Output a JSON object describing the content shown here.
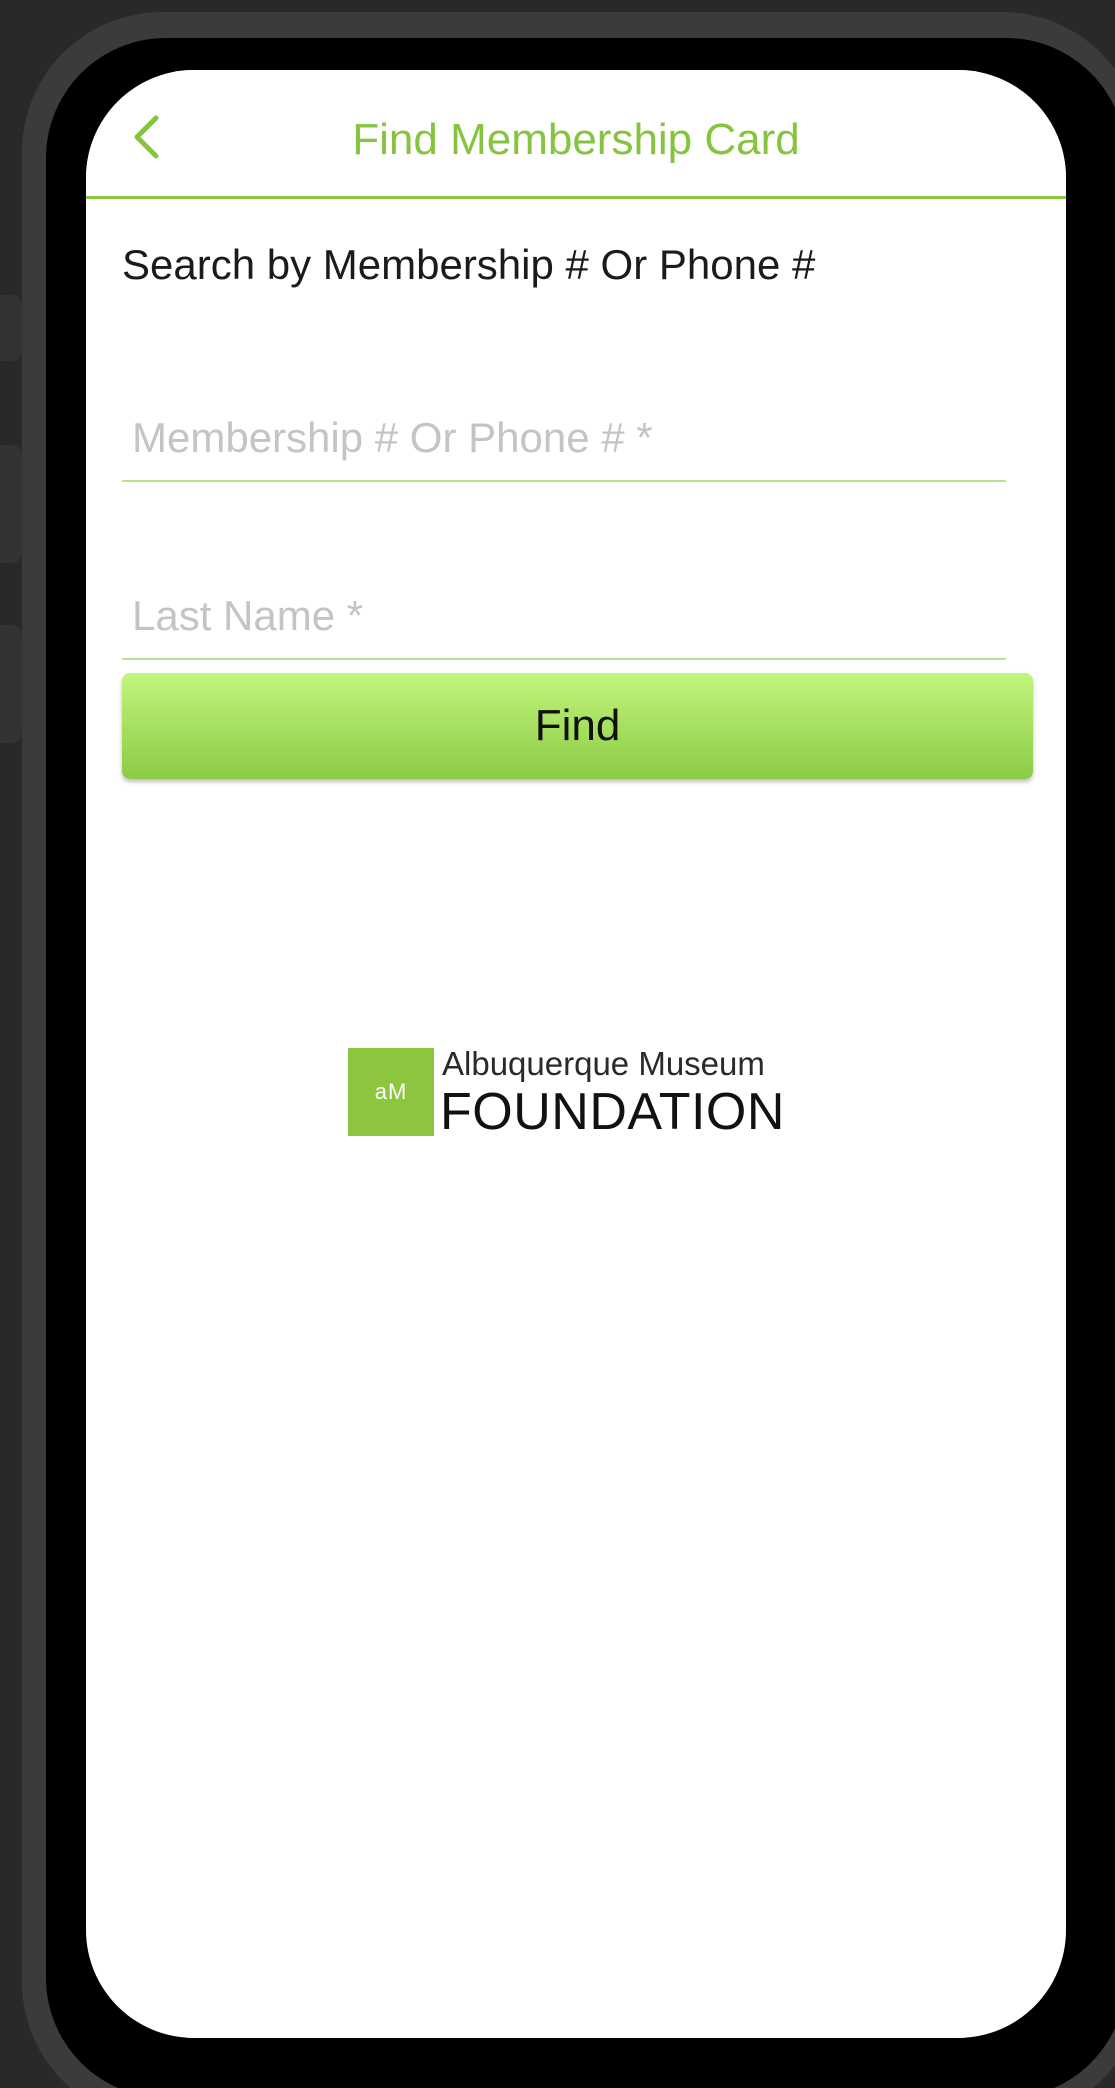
{
  "header": {
    "back_icon": "chevron-left-icon",
    "title": "Find Membership Card"
  },
  "form": {
    "section_label": "Search by Membership # Or Phone #",
    "membership_field": {
      "placeholder": "Membership # Or Phone # *",
      "value": ""
    },
    "last_name_field": {
      "placeholder": "Last Name *",
      "value": ""
    },
    "find_button_label": "Find"
  },
  "logo": {
    "mark_text": "aM",
    "line1": "Albuquerque Museum",
    "line2": "FOUNDATION"
  },
  "colors": {
    "accent": "#8cc63f",
    "button_gradient_top": "#c2f57d",
    "button_gradient_bottom": "#8ccb45",
    "bezel": "#3b3b3b",
    "background": "#2b2829"
  }
}
